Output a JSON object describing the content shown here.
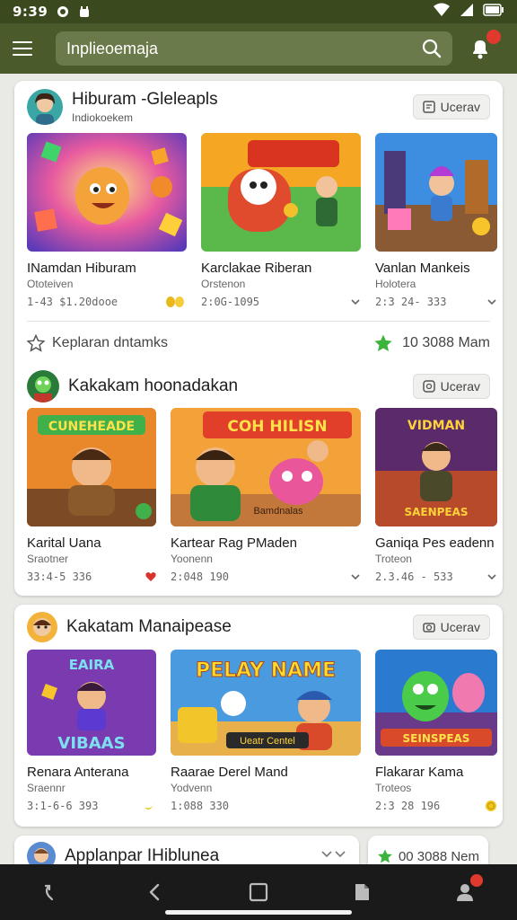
{
  "status": {
    "time": "9:39"
  },
  "search": {
    "value": "Inplieoemaja"
  },
  "notifications": {
    "count": ""
  },
  "sections": [
    {
      "title": "Hiburam -Gleleapls",
      "subtitle": "Indiokoekem",
      "view_label": "Ucerav",
      "games": [
        {
          "name": "INamdan Hiburam",
          "sub": "Ototeiven",
          "meta": "1-43 $1.20dooe"
        },
        {
          "name": "Karclakae Riberan",
          "sub": "Orstenon",
          "meta": "2:0G-1095"
        },
        {
          "name": "Vanlan Mankeis",
          "sub": "Holotera",
          "meta": "2:3 24- 333"
        }
      ],
      "footer_left": "Keplaran dntamks",
      "footer_right": "10 3088 Mam"
    },
    {
      "title": "Kakakam hoonadakan",
      "subtitle": "",
      "view_label": "Ucerav",
      "games": [
        {
          "name": "Karital Uana",
          "sub": "Sraotner",
          "meta": "33:4-5 336",
          "banner": "CUNEHEADE"
        },
        {
          "name": "Kartear Rag PMaden",
          "sub": "Yoonenn",
          "meta": "2:048 190",
          "banner": "COH HILISN"
        },
        {
          "name": "Ganiqa Pes eadenn",
          "sub": "Troteon",
          "meta": "2.3.46 - 533",
          "banner": "VIDMAN",
          "banner2": "SAENPEAS"
        }
      ]
    },
    {
      "title": "Kakatam Manaipease",
      "subtitle": "",
      "view_label": "Ucerav",
      "games": [
        {
          "name": "Renara Anterana",
          "sub": "Sraennr",
          "meta": "3:1-6-6 393",
          "banner": "EAIRA",
          "banner2": "VIBAAS"
        },
        {
          "name": "Raarae Derel Mand",
          "sub": "Yodvenn",
          "meta": "1:088 330",
          "banner": "PELAY NAME",
          "banner2": "Ueatr Centel"
        },
        {
          "name": "Flakarar Kama",
          "sub": "Troteos",
          "meta": "2:3 28 196",
          "banner": "SEINSPEAS"
        }
      ]
    }
  ],
  "bottom": {
    "left_title": "Applanpar IHiblunea",
    "right_text": "00 3088 Nem"
  },
  "colors": {
    "appbar": "#4a5a2a",
    "statusbar": "#3b4a1e",
    "accent_green": "#3cb43c",
    "badge_red": "#e2392f"
  }
}
